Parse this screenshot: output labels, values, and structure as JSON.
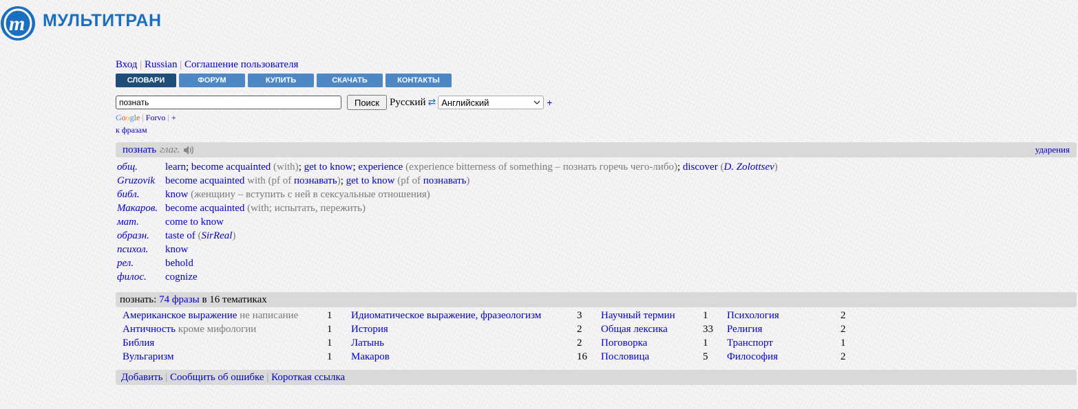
{
  "header": {
    "logo_text": "МУЛЬТИТРАН",
    "logo_letter": "m"
  },
  "toplinks": [
    "Вход",
    "Russian",
    "Соглашение пользователя"
  ],
  "tabs": [
    {
      "label": "СЛОВАРИ",
      "active": true
    },
    {
      "label": "ФОРУМ",
      "active": false
    },
    {
      "label": "КУПИТЬ",
      "active": false
    },
    {
      "label": "СКАЧАТЬ",
      "active": false
    },
    {
      "label": "КОНТАКТЫ",
      "active": false
    }
  ],
  "search": {
    "value": "познать",
    "button": "Поиск",
    "lang_from": "Русский",
    "swap_glyph": "⇄",
    "lang_to": "Английский",
    "plus": "+"
  },
  "ext": {
    "forvo": "Forvo",
    "plus": "+",
    "phrases": "к фразам"
  },
  "entry": {
    "word": "познать",
    "pos": "глаг.",
    "stress": "ударения"
  },
  "senses": [
    {
      "subject": "общ.",
      "parts": [
        [
          "learn",
          "l"
        ],
        [
          "; ",
          "s"
        ],
        [
          "become acquainted",
          "l"
        ],
        [
          " (with)",
          "g"
        ],
        [
          "; ",
          "s"
        ],
        [
          "get to know",
          "l"
        ],
        [
          "; ",
          "s"
        ],
        [
          "experience",
          "l"
        ],
        [
          " (experience bitterness of something – познать горечь чего-либо)",
          "g"
        ],
        [
          "; ",
          "s"
        ],
        [
          "discover",
          "l"
        ],
        [
          " (",
          "g"
        ],
        [
          "D. Zolottsev",
          "i"
        ],
        [
          ")",
          "g"
        ]
      ]
    },
    {
      "subject": "Gruzovik",
      "parts": [
        [
          "become acquainted",
          "l"
        ],
        [
          " with (pf of ",
          "g"
        ],
        [
          "познавать",
          "l"
        ],
        [
          ")",
          "g"
        ],
        [
          "; ",
          "s"
        ],
        [
          "get to know",
          "l"
        ],
        [
          " (pf of ",
          "g"
        ],
        [
          "познавать",
          "l"
        ],
        [
          ")",
          "g"
        ]
      ]
    },
    {
      "subject": "библ.",
      "parts": [
        [
          "know",
          "l"
        ],
        [
          " (женщину – вступить с ней в сексуальные отношения)",
          "g"
        ]
      ]
    },
    {
      "subject": "Макаров.",
      "parts": [
        [
          "become acquainted",
          "l"
        ],
        [
          " (with; испытать, пережить)",
          "g"
        ]
      ]
    },
    {
      "subject": "мат.",
      "parts": [
        [
          "come to know",
          "l"
        ]
      ]
    },
    {
      "subject": "образн.",
      "parts": [
        [
          "taste of",
          "l"
        ],
        [
          " (",
          "g"
        ],
        [
          "SirReal",
          "i"
        ],
        [
          ")",
          "g"
        ]
      ]
    },
    {
      "subject": "психол.",
      "parts": [
        [
          "know",
          "l"
        ]
      ]
    },
    {
      "subject": "рел.",
      "parts": [
        [
          "behold",
          "l"
        ]
      ]
    },
    {
      "subject": "филос.",
      "parts": [
        [
          "cognize",
          "l"
        ]
      ]
    }
  ],
  "phrases": {
    "word": "познать:",
    "count_link": "74 фразы",
    "suffix": "в 16 тематиках"
  },
  "topics": [
    [
      {
        "name": "Американское выражение",
        "note": " не написание",
        "count": "1"
      },
      {
        "name": "Античность",
        "note": " кроме мифологии",
        "count": "1"
      },
      {
        "name": "Библия",
        "note": "",
        "count": "1"
      },
      {
        "name": "Вульгаризм",
        "note": "",
        "count": "1"
      }
    ],
    [
      {
        "name": "Идиоматическое выражение, фразеологизм",
        "note": "",
        "count": "3"
      },
      {
        "name": "История",
        "note": "",
        "count": "2"
      },
      {
        "name": "Латынь",
        "note": "",
        "count": "2"
      },
      {
        "name": "Макаров",
        "note": "",
        "count": "16"
      }
    ],
    [
      {
        "name": "Научный термин",
        "note": "",
        "count": "1"
      },
      {
        "name": "Общая лексика",
        "note": "",
        "count": "33"
      },
      {
        "name": "Поговорка",
        "note": "",
        "count": "1"
      },
      {
        "name": "Пословица",
        "note": "",
        "count": "5"
      }
    ],
    [
      {
        "name": "Психология",
        "note": "",
        "count": "2"
      },
      {
        "name": "Религия",
        "note": "",
        "count": "2"
      },
      {
        "name": "Транспорт",
        "note": "",
        "count": "1"
      },
      {
        "name": "Философия",
        "note": "",
        "count": "2"
      }
    ]
  ],
  "footer": [
    "Добавить",
    "Сообщить об ошибке",
    "Короткая ссылка"
  ],
  "icons": {
    "speaker": "speaker-icon",
    "dropdown": "chevron-down-icon",
    "swap": "swap-icon"
  },
  "colors": {
    "link": "#0000cc",
    "tab": "#4d88c4",
    "tab_active": "#1f4d7a",
    "logo": "#1a6fc0",
    "bar": "#d9d9d9"
  }
}
